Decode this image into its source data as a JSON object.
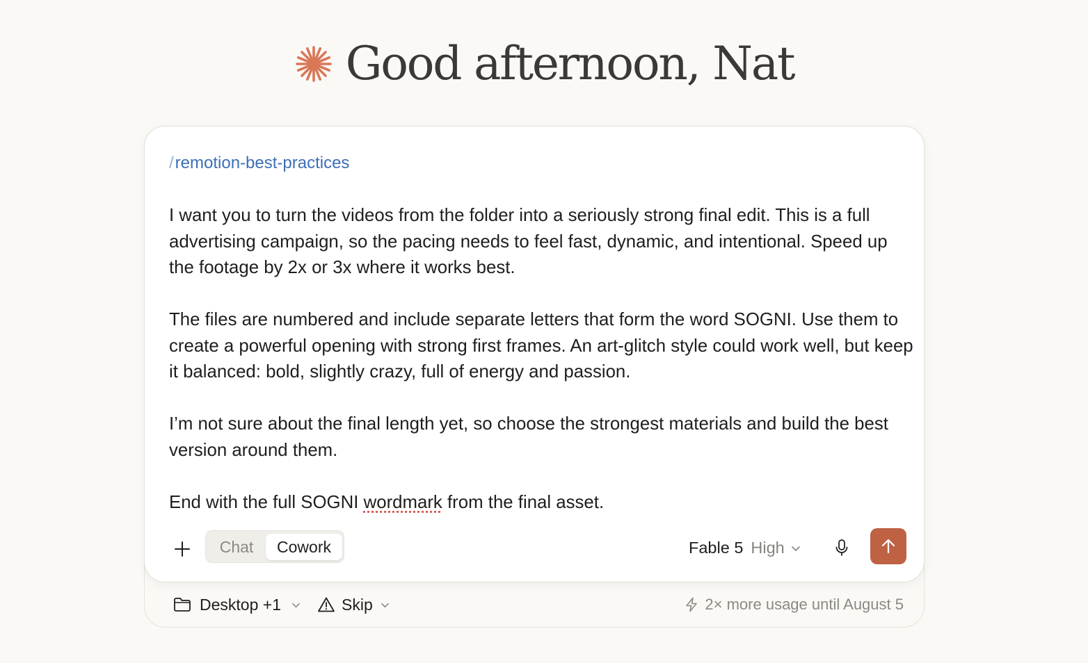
{
  "greeting": {
    "logo_icon": "sparkle-asterisk-icon",
    "logo_color": "#d97757",
    "text": "Good afternoon, Nat"
  },
  "composer": {
    "command_slash": "/",
    "command_name": "remotion-best-practices",
    "message_paragraphs": [
      "I want you to turn the videos from the folder into a seriously strong final edit. This is a full advertising campaign, so the pacing needs to feel fast, dynamic, and intentional. Speed up the footage by 2x or 3x where it works best.",
      "The files are numbered and include separate letters that form the word SOGNI. Use them to create a powerful opening with strong first frames. An art-glitch style could work well, but keep it balanced: bold, slightly crazy, full of energy and passion.",
      "I’m not sure about the final length yet, so choose the strongest materials and build the best version around them."
    ],
    "last_paragraph": {
      "before": "End with the full SOGNI ",
      "misspelled_word": "wordmark",
      "after": " from the final asset."
    }
  },
  "toolbar": {
    "add_icon": "plus-icon",
    "modes": {
      "chat": "Chat",
      "cowork": "Cowork",
      "active": "cowork"
    },
    "model": {
      "name": "Fable 5",
      "effort": "High"
    },
    "mic_icon": "microphone-icon",
    "send_icon": "arrow-up-icon",
    "send_color": "#bf6244"
  },
  "footer": {
    "folder_label": "Desktop +1",
    "folder_icon": "folder-icon",
    "permission_label": "Skip",
    "permission_icon": "warning-triangle-icon",
    "usage_icon": "lightning-icon",
    "usage_text": "2× more usage until August 5"
  }
}
